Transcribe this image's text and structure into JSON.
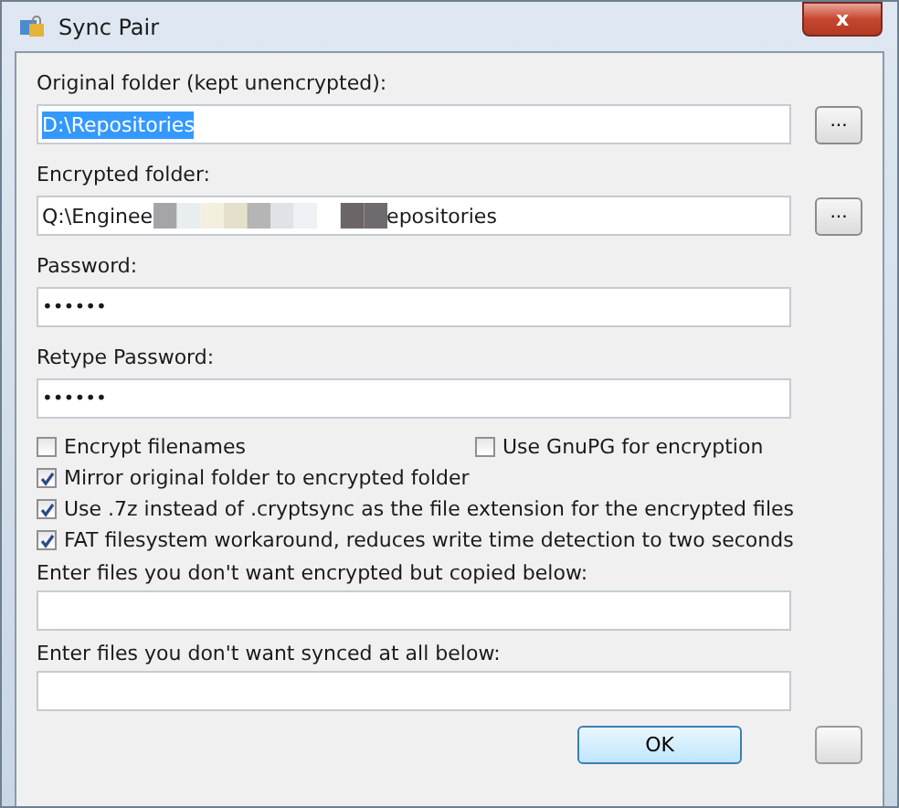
{
  "window": {
    "title": "Sync Pair",
    "close": "x"
  },
  "folders": [
    {
      "label": "Original folder (kept unencrypted):",
      "value": "D:\\Repositories",
      "selected": true,
      "browse": "..."
    },
    {
      "label": "Encrypted folder:",
      "value": "Q:\\Enginee",
      "value_end": "epositories",
      "redacted": true,
      "selected": false,
      "browse": "..."
    }
  ],
  "passwords": [
    {
      "label": "Password:",
      "value": "••••••"
    },
    {
      "label": "Retype Password:",
      "value": "••••••"
    }
  ],
  "option_rows": [
    {
      "items": [
        {
          "label": "Encrypt filenames",
          "checked": false
        },
        {
          "label": "Use GnuPG for encryption",
          "checked": false
        }
      ]
    },
    {
      "items": [
        {
          "label": "Mirror original folder to encrypted folder",
          "checked": true
        }
      ]
    },
    {
      "items": [
        {
          "label": "Use .7z instead of .cryptsync as the file extension for the encrypted files",
          "checked": true
        }
      ]
    },
    {
      "items": [
        {
          "label": "FAT filesystem workaround, reduces write time detection to two seconds",
          "checked": true
        }
      ]
    }
  ],
  "lists": [
    {
      "label": "Enter files you don't want encrypted but copied below:"
    },
    {
      "label": "Enter files you don't want synced at all below:"
    }
  ],
  "buttons": {
    "ok": "OK"
  }
}
